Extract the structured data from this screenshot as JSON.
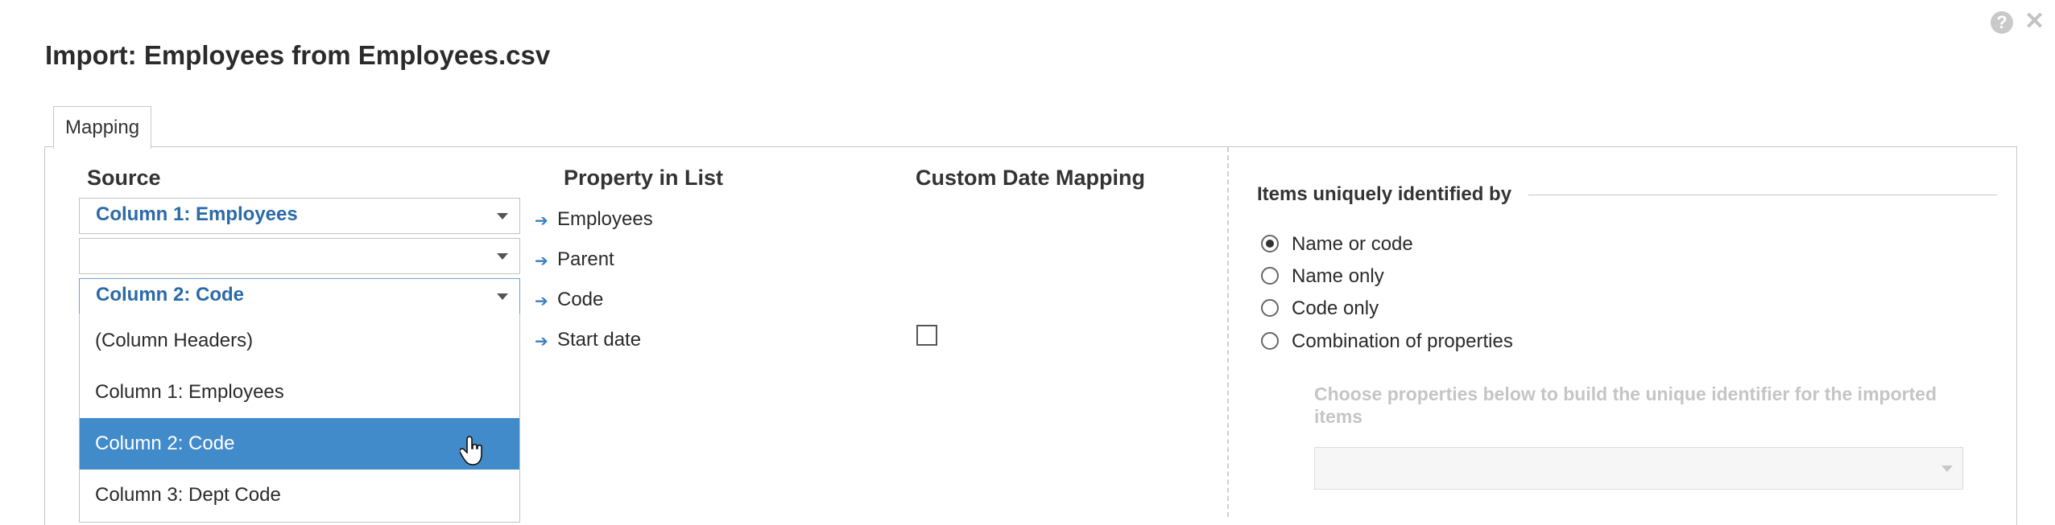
{
  "dialog": {
    "title": "Import: Employees from Employees.csv",
    "help_icon": "help-icon",
    "close_icon": "close-icon"
  },
  "tabs": [
    {
      "label": "Mapping",
      "active": true
    }
  ],
  "columns": {
    "source": "Source",
    "property": "Property in List",
    "custom_date": "Custom Date Mapping"
  },
  "mapping_rows": [
    {
      "source_value": "Column 1: Employees",
      "property": "Employees"
    },
    {
      "source_value": "",
      "property": "Parent"
    },
    {
      "source_value": "Column 2: Code",
      "property": "Code"
    },
    {
      "source_value": "",
      "property": "Start date",
      "custom_date_checked": false
    }
  ],
  "dropdown": {
    "open_on_row": 2,
    "options": [
      "(Column Headers)",
      "Column 1: Employees",
      "Column 2: Code",
      "Column 3: Dept Code"
    ],
    "selected_index": 2
  },
  "unique_id": {
    "legend": "Items uniquely identified by",
    "options": [
      "Name or code",
      "Name only",
      "Code only",
      "Combination of properties"
    ],
    "selected_index": 0,
    "hint": "Choose properties below to build the unique identifier for the imported items",
    "combo_value": ""
  },
  "colors": {
    "accent": "#428bca",
    "link_text": "#2a6aa8",
    "disabled_text": "#c5c5c5"
  }
}
